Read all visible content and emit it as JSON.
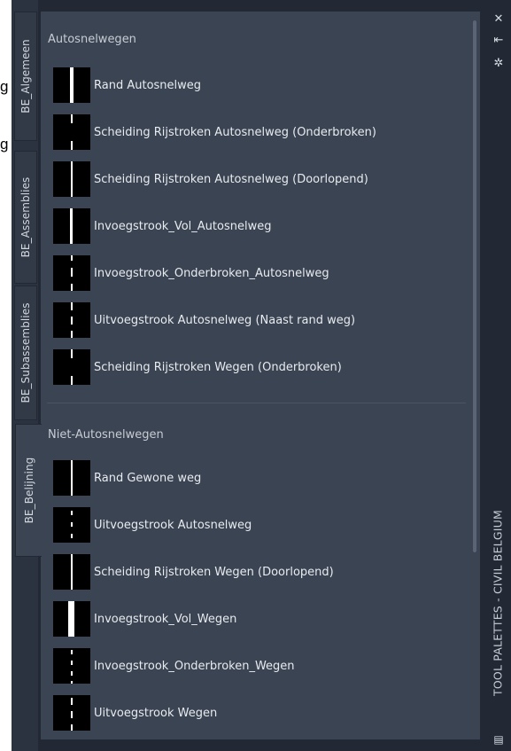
{
  "background_fragments": [
    "g",
    "g"
  ],
  "palette": {
    "title": "TOOL PALETTES - CIVIL BELGIUM",
    "tabs": [
      {
        "label": "BE_Algemeen",
        "active": false
      },
      {
        "label": "BE_Assemblies",
        "active": false
      },
      {
        "label": "BE_Subassemblies",
        "active": false
      },
      {
        "label": "BE_Belijning",
        "active": true
      }
    ],
    "sections": [
      {
        "title": "Autosnelwegen",
        "items": [
          {
            "label": "Rand Autosnelweg",
            "icon": "solid-line-thumbnail"
          },
          {
            "label": "Scheiding Rijstroken Autosnelweg (Onderbroken)",
            "icon": "dashed-line-thumbnail"
          },
          {
            "label": "Scheiding Rijstroken Autosnelweg (Doorlopend)",
            "icon": "solid-line-thumbnail"
          },
          {
            "label": "Invoegstrook_Vol_Autosnelweg",
            "icon": "solid-line-thumbnail"
          },
          {
            "label": "Invoegstrook_Onderbroken_Autosnelweg",
            "icon": "dashed-line-thumbnail"
          },
          {
            "label": "Uitvoegstrook Autosnelweg (Naast rand weg)",
            "icon": "dashed-line-thumbnail"
          },
          {
            "label": "Scheiding Rijstroken Wegen (Onderbroken)",
            "icon": "dashed-line-thumbnail"
          }
        ]
      },
      {
        "title": "Niet-Autosnelwegen",
        "items": [
          {
            "label": "Rand Gewone weg",
            "icon": "solid-line-thumbnail"
          },
          {
            "label": "Uitvoegstrook Autosnelweg",
            "icon": "dotted-line-thumbnail"
          },
          {
            "label": "Scheiding Rijstroken Wegen (Doorlopend)",
            "icon": "solid-line-thumbnail"
          },
          {
            "label": "Invoegstrook_Vol_Wegen",
            "icon": "thick-solid-line-thumbnail"
          },
          {
            "label": "Invoegstrook_Onderbroken_Wegen",
            "icon": "dotted-line-thumbnail"
          },
          {
            "label": "Uitvoegstrook Wegen",
            "icon": "dashed-line-thumbnail"
          }
        ]
      }
    ],
    "controls": {
      "close_icon": "close-icon",
      "autohide_icon": "autohide-icon",
      "properties_icon": "properties-icon",
      "menu_icon": "palette-menu-icon"
    }
  },
  "colors": {
    "panel_bg": "#222935",
    "content_bg": "#3b4453",
    "tab_bg": "#323a47",
    "text": "#e8ebef",
    "line_white": "#ffffff",
    "thumb_bg": "#000000"
  }
}
